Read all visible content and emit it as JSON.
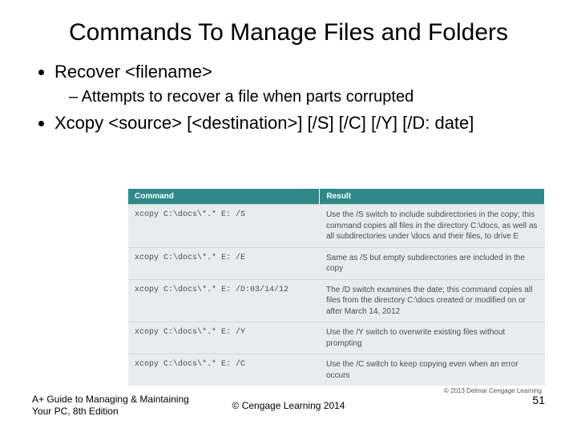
{
  "title": "Commands To Manage Files and Folders",
  "bullets": {
    "b1": "Recover <filename>",
    "b1_sub": "Attempts to recover a file when parts corrupted",
    "b2": "Xcopy <source> [<destination>] [/S] [/C] [/Y] [/D: date]"
  },
  "table": {
    "head_cmd": "Command",
    "head_res": "Result",
    "rows": [
      {
        "cmd": "xcopy C:\\docs\\*.* E: /S",
        "res": "Use the /S switch to include subdirectories in the copy; this command copies all files in the directory C:\\docs, as well as all subdirectories under \\docs and their files, to drive E"
      },
      {
        "cmd": "xcopy C:\\docs\\*.* E: /E",
        "res": "Same as /S but empty subdirectories are included in the copy"
      },
      {
        "cmd": "xcopy C:\\docs\\*.* E: /D:03/14/12",
        "res": "The /D switch examines the date; this command copies all files from the directory C:\\docs created or modified on or after March 14, 2012"
      },
      {
        "cmd": "xcopy C:\\docs\\*.* E: /Y",
        "res": "Use the /Y switch to overwrite existing files without prompting"
      },
      {
        "cmd": "xcopy C:\\docs\\*.* E: /C",
        "res": "Use the /C switch to keep copying even when an error occurs"
      }
    ],
    "credit": "© 2013 Delmar Cengage Learning"
  },
  "footer": {
    "left": "A+ Guide to Managing & Maintaining Your PC, 8th Edition",
    "center": "© Cengage Learning  2014",
    "page": "51"
  }
}
